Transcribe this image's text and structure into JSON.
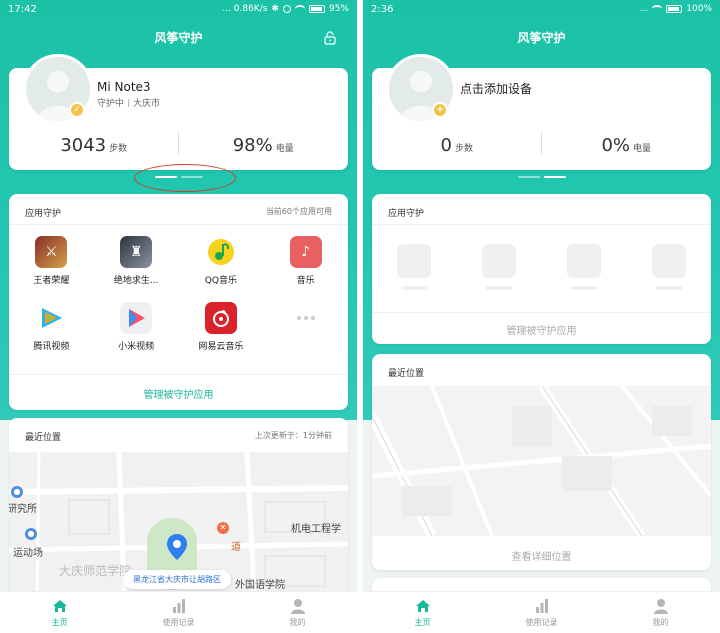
{
  "left": {
    "status": {
      "time": "17:42",
      "net": "... 0.86K/s",
      "battery": "95%"
    },
    "title": "风筝守护",
    "device": {
      "name": "Mi Note3",
      "status": "守护中",
      "city": "大庆市",
      "steps_value": "3043",
      "steps_unit": "步数",
      "battery_value": "98%",
      "battery_unit": "电量"
    },
    "apps_card": {
      "title": "应用守护",
      "hint": "当前60个应用可用",
      "apps": [
        {
          "label": "王者荣耀",
          "color": "#c0392b",
          "icon": "honor-of-kings-icon"
        },
        {
          "label": "绝地求生...",
          "color": "#4a5566",
          "icon": "pubg-icon"
        },
        {
          "label": "QQ音乐",
          "color": "#f7d21e",
          "icon": "qq-music-icon"
        },
        {
          "label": "音乐",
          "color": "#e85a5a",
          "icon": "music-icon"
        },
        {
          "label": "腾讯视频",
          "color": "#1fb5e9",
          "icon": "tencent-video-icon"
        },
        {
          "label": "小米视频",
          "color": "#3d8ef0",
          "icon": "mi-video-icon"
        },
        {
          "label": "网易云音乐",
          "color": "#d9222a",
          "icon": "netease-music-icon"
        }
      ],
      "manage": "管理被守护应用"
    },
    "location": {
      "title": "最近位置",
      "updated": "上次更新于：1分钟前",
      "address": "黑龙江省大庆市让胡路区",
      "map_labels": {
        "research": "研究所",
        "sports": "运动场",
        "normal_univ": "大庆师范学院",
        "mech": "机电工程学",
        "foreign": "外国语学院",
        "road": "道"
      }
    }
  },
  "right": {
    "status": {
      "time": "2:36",
      "net": "...",
      "battery": "100%"
    },
    "title": "风筝守护",
    "device": {
      "add": "点击添加设备",
      "steps_value": "0",
      "steps_unit": "步数",
      "battery_value": "0%",
      "battery_unit": "电量"
    },
    "apps_card": {
      "title": "应用守护",
      "manage": "管理被守护应用"
    },
    "location": {
      "title": "最近位置",
      "view": "查看详细位置"
    }
  },
  "tabs": [
    {
      "label": "主页",
      "icon": "home-icon"
    },
    {
      "label": "使用记录",
      "icon": "bar-chart-icon"
    },
    {
      "label": "我的",
      "icon": "user-icon"
    }
  ],
  "colors": {
    "accent": "#18b89a",
    "header": "#1cc2a6",
    "highlight_ring": "#d23b30"
  }
}
